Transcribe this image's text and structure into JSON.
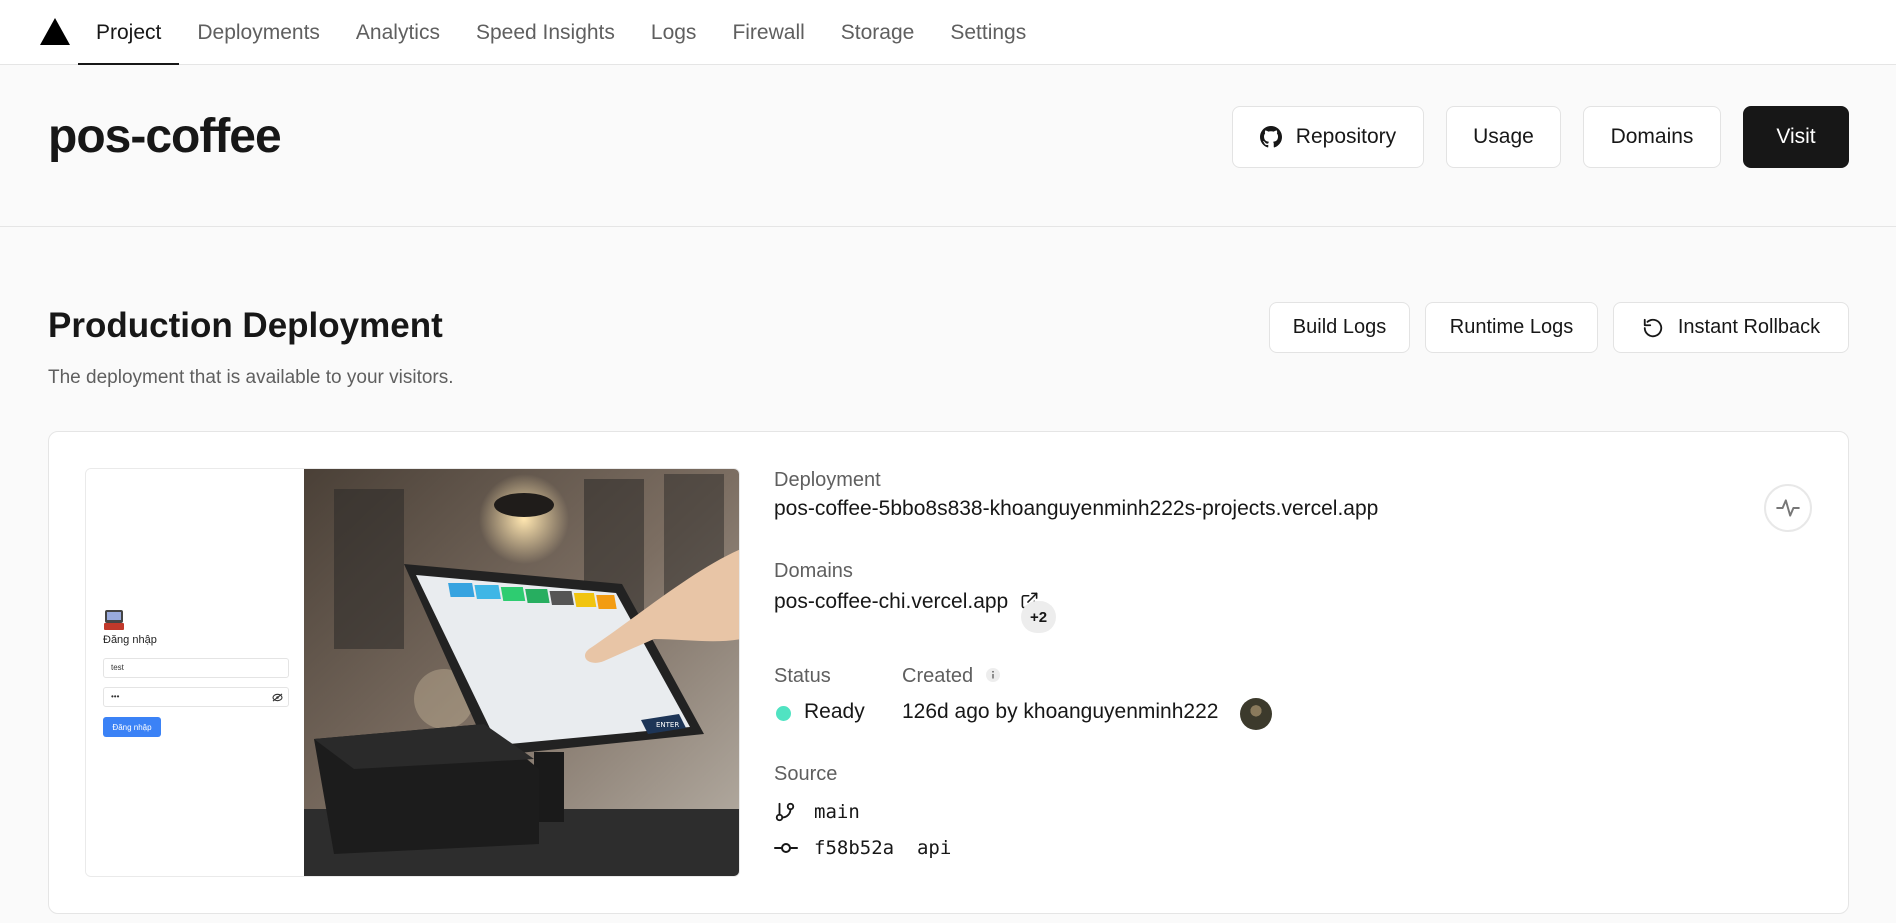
{
  "nav": {
    "tabs": [
      "Project",
      "Deployments",
      "Analytics",
      "Speed Insights",
      "Logs",
      "Firewall",
      "Storage",
      "Settings"
    ]
  },
  "header": {
    "title": "pos-coffee",
    "buttons": {
      "repository": "Repository",
      "usage": "Usage",
      "domains": "Domains",
      "visit": "Visit"
    }
  },
  "production": {
    "title": "Production Deployment",
    "description": "The deployment that is available to your visitors.",
    "buttons": {
      "build_logs": "Build Logs",
      "runtime_logs": "Runtime Logs",
      "instant_rollback": "Instant Rollback"
    }
  },
  "preview": {
    "login_title": "Đăng nhập",
    "username_value": "test",
    "password_value": "•••",
    "login_button": "Đăng nhập",
    "pos_enter": "ENTER"
  },
  "deployment": {
    "label": "Deployment",
    "url": "pos-coffee-5bbo8s838-khoanguyenminh222s-projects.vercel.app",
    "domains_label": "Domains",
    "domain": "pos-coffee-chi.vercel.app",
    "domains_extra": "+2",
    "status_label": "Status",
    "status": "Ready",
    "created_label": "Created",
    "created": "126d ago by khoanguyenminh222",
    "source_label": "Source",
    "branch": "main",
    "commit": "f58b52a  api"
  },
  "colors": {
    "accent": "#171717",
    "ready": "#50e3c2",
    "primary_blue": "#3b82f6"
  }
}
